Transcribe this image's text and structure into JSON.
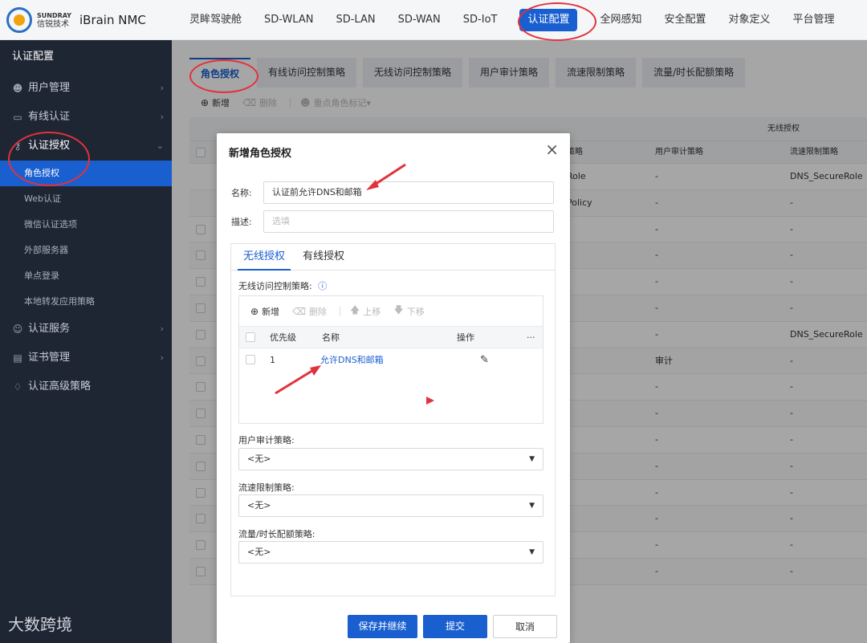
{
  "brand": {
    "en": "SUNDRAY",
    "cn": "信锐技术",
    "product": "iBrain NMC"
  },
  "topnav": [
    "灵眸驾驶舱",
    "SD-WLAN",
    "SD-LAN",
    "SD-WAN",
    "SD-IoT",
    "认证配置",
    "全网感知",
    "安全配置",
    "对象定义",
    "平台管理"
  ],
  "sidebar": {
    "title": "认证配置",
    "groups": {
      "user_mgmt": "用户管理",
      "wired_auth": "有线认证",
      "auth_grant": "认证授权",
      "auth_service": "认证服务",
      "cert_mgmt": "证书管理",
      "advanced": "认证高级策略"
    },
    "subs": {
      "role": "角色授权",
      "web": "Web认证",
      "wechat": "微信认证选项",
      "external": "外部服务器",
      "sso": "单点登录",
      "local": "本地转发应用策略"
    },
    "watermark": "大数跨境"
  },
  "tabs": [
    "角色授权",
    "有线访问控制策略",
    "无线访问控制策略",
    "用户审计策略",
    "流速限制策略",
    "流量/时长配额策略"
  ],
  "toolbar": {
    "add": "新增",
    "delete": "删除",
    "mark": "重点角色标记"
  },
  "grid": {
    "group_header": "无线授权",
    "col_policy": "策略",
    "col_audit": "用户审计策略",
    "col_rate": "流速限制策略",
    "rows": [
      {
        "policy": "Role",
        "audit": "-",
        "rate": "DNS_SecureRole"
      },
      {
        "policy": "Policy",
        "audit": "-",
        "rate": "-"
      },
      {
        "policy": "",
        "audit": "-",
        "rate": "-"
      },
      {
        "policy": "",
        "audit": "-",
        "rate": "-"
      },
      {
        "policy": "",
        "audit": "-",
        "rate": "-"
      },
      {
        "policy": "",
        "audit": "-",
        "rate": "-"
      },
      {
        "policy": "",
        "audit": "-",
        "rate": "DNS_SecureRole"
      },
      {
        "policy": "",
        "audit": "审计",
        "rate": "-"
      },
      {
        "policy": "",
        "audit": "-",
        "rate": "-"
      },
      {
        "policy": "",
        "audit": "-",
        "rate": "-"
      },
      {
        "policy": "",
        "audit": "-",
        "rate": "-"
      },
      {
        "policy": "",
        "audit": "-",
        "rate": "-"
      },
      {
        "policy": "",
        "audit": "-",
        "rate": "-"
      },
      {
        "policy": "",
        "audit": "-",
        "rate": "-"
      },
      {
        "policy": "",
        "audit": "-",
        "rate": "-"
      },
      {
        "policy": "",
        "audit": "-",
        "rate": "-"
      }
    ]
  },
  "dialog": {
    "title": "新增角色授权",
    "name_label": "名称:",
    "name_value": "认证前允许DNS和邮箱",
    "desc_label": "描述:",
    "desc_placeholder": "选填",
    "tab_wireless": "无线授权",
    "tab_wired": "有线授权",
    "acl_label": "无线访问控制策略:",
    "acl_toolbar": {
      "add": "新增",
      "delete": "删除",
      "up": "上移",
      "down": "下移"
    },
    "acl_cols": {
      "priority": "优先级",
      "name": "名称",
      "action": "操作",
      "more": "···"
    },
    "acl_row": {
      "priority": "1",
      "name": "允许DNS和邮箱"
    },
    "audit_label": "用户审计策略:",
    "audit_value": "<无>",
    "rate_label": "流速限制策略:",
    "rate_value": "<无>",
    "quota_label": "流量/时长配额策略:",
    "quota_value": "<无>",
    "btn_save_continue": "保存并继续",
    "btn_submit": "提交",
    "btn_cancel": "取消"
  },
  "colors": {
    "primary": "#1a5fd0",
    "sidebar_bg": "#1f2633",
    "annotation": "#e2323b"
  }
}
